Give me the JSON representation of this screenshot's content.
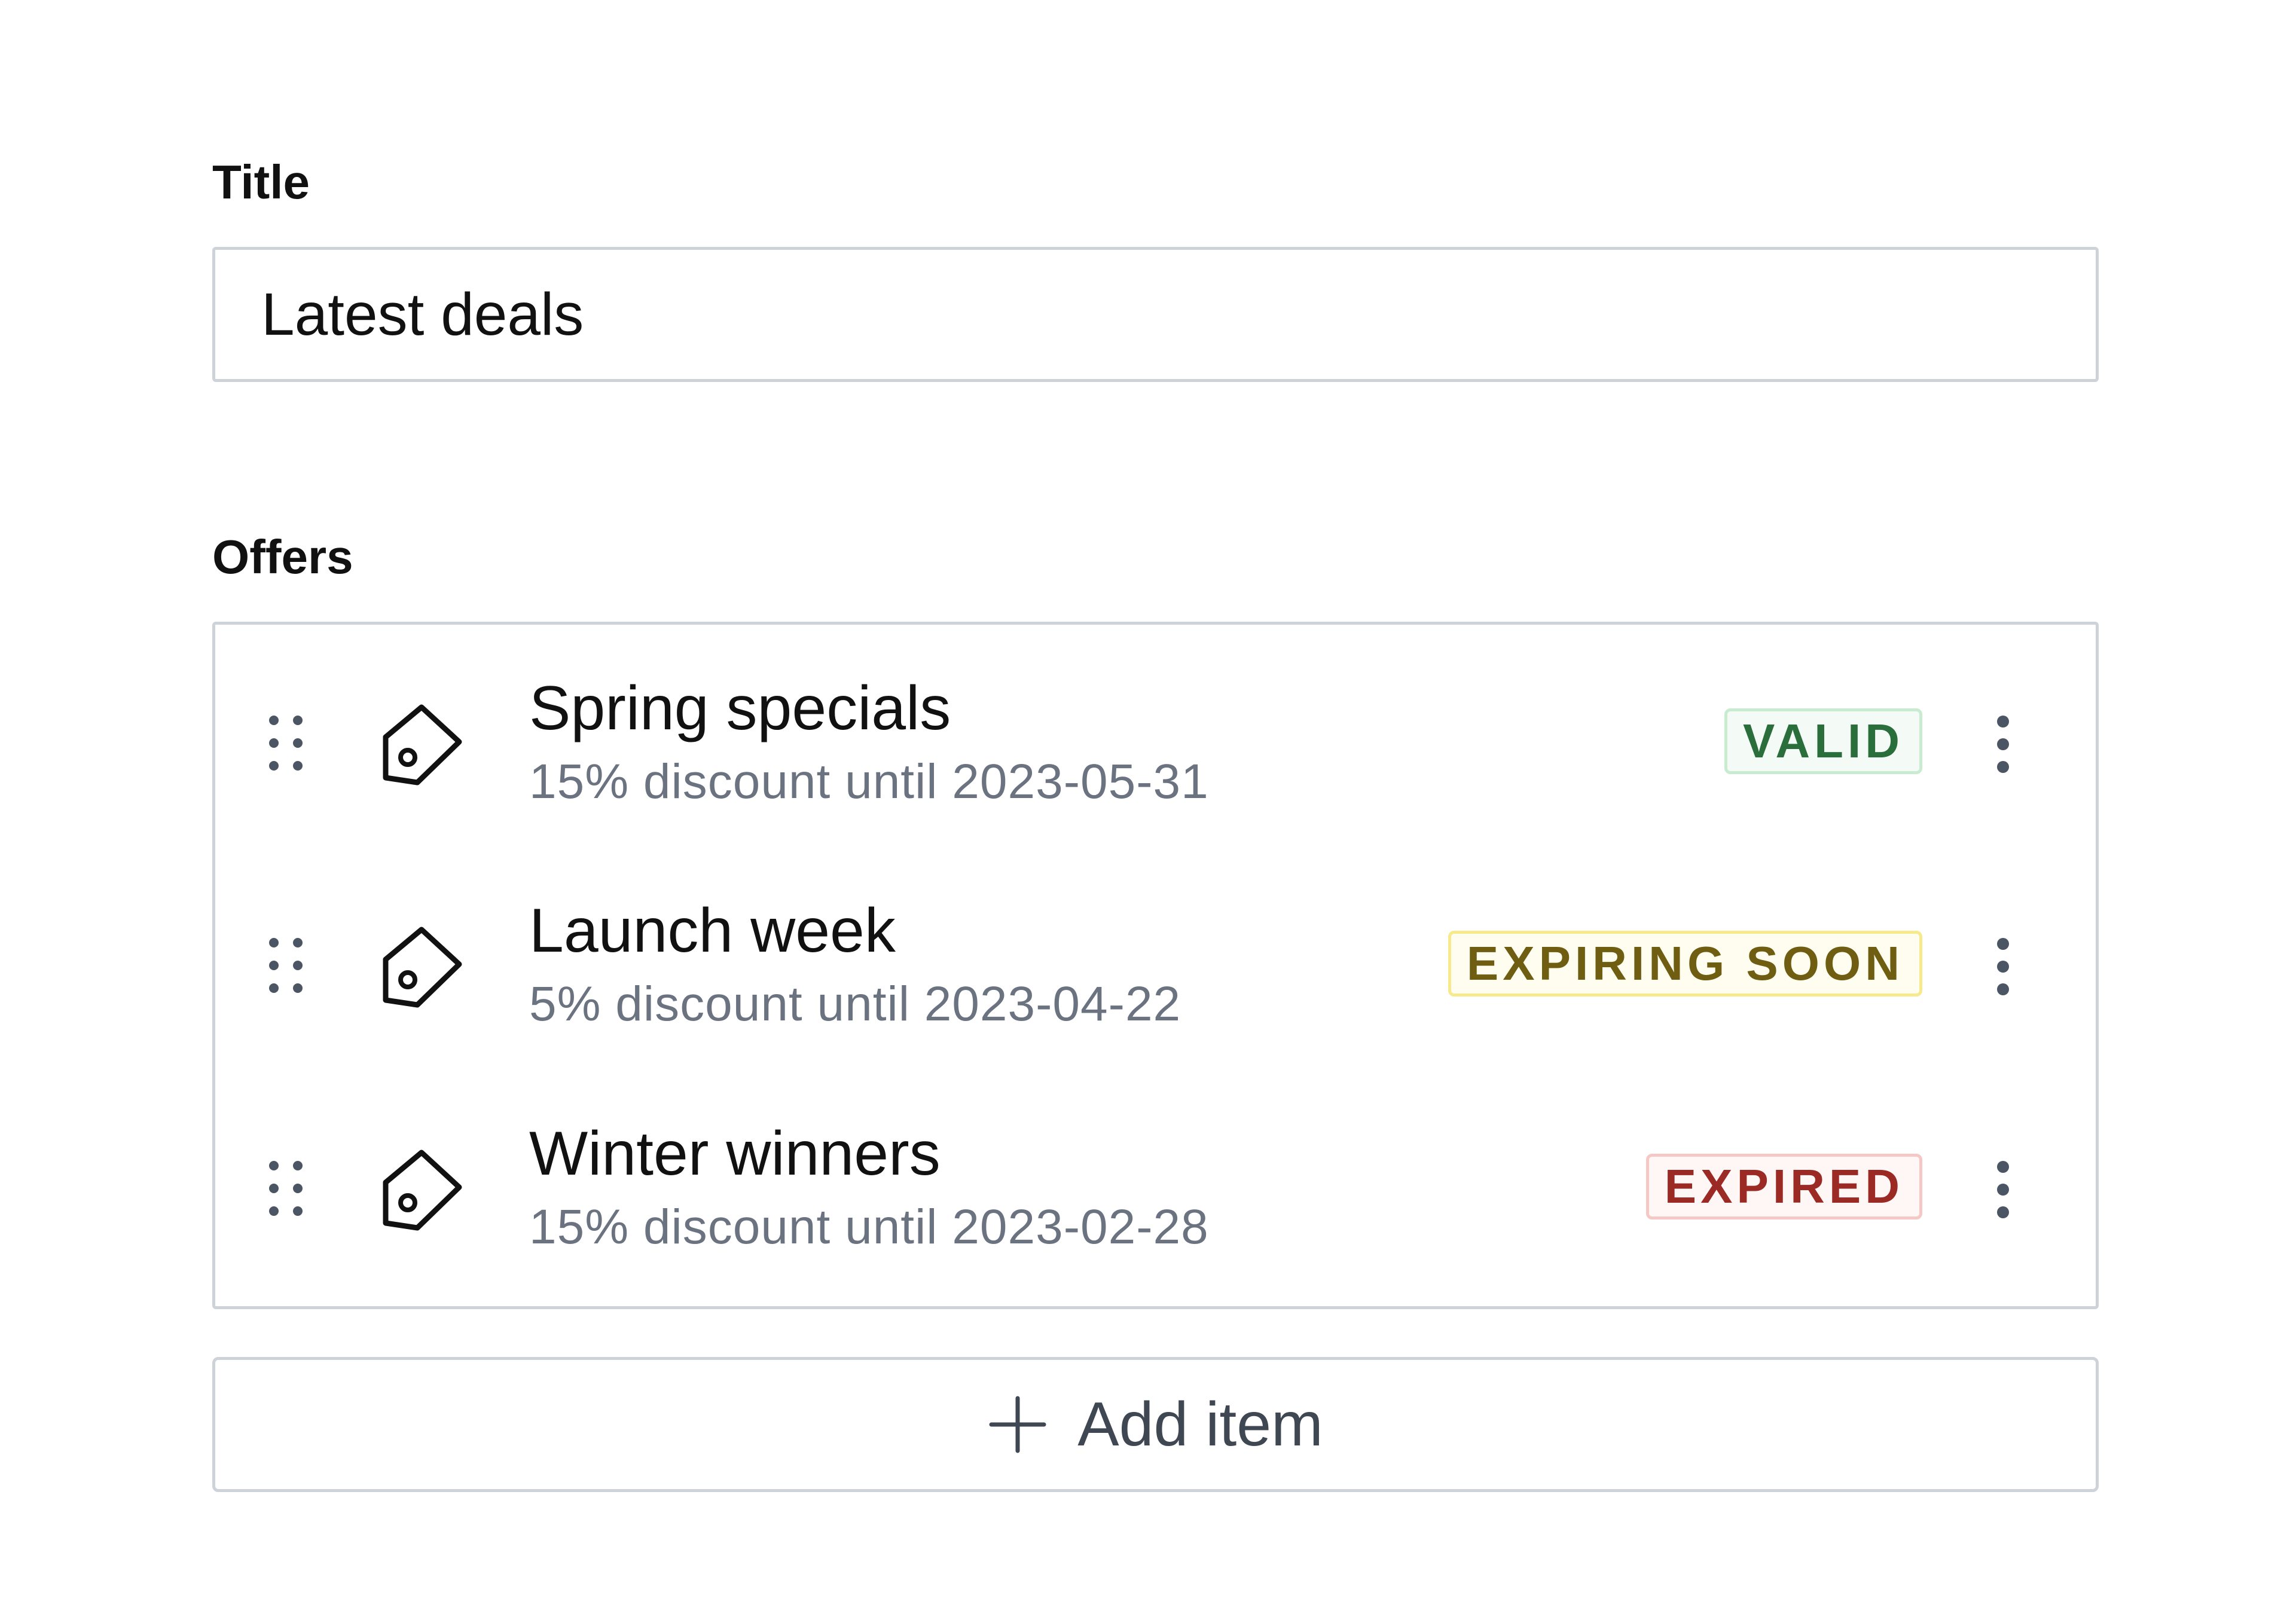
{
  "form": {
    "title_label": "Title",
    "title_value": "Latest deals",
    "offers_label": "Offers",
    "add_item_label": "Add item"
  },
  "offers": [
    {
      "title": "Spring specials",
      "subtitle": "15% discount until 2023-05-31",
      "status": "VALID",
      "status_kind": "valid",
      "status_color": "#2a6e3b"
    },
    {
      "title": "Launch week",
      "subtitle": "5% discount until 2023-04-22",
      "status": "EXPIRING SOON",
      "status_kind": "soon",
      "status_color": "#6f5e11"
    },
    {
      "title": "Winter winners",
      "subtitle": "15% discount until 2023-02-28",
      "status": "EXPIRED",
      "status_kind": "expired",
      "status_color": "#9b2a24"
    }
  ],
  "icons": {
    "drag": "drag-handle-icon",
    "tag": "tag-icon",
    "menu": "more-vertical-icon",
    "add": "plus-icon"
  }
}
